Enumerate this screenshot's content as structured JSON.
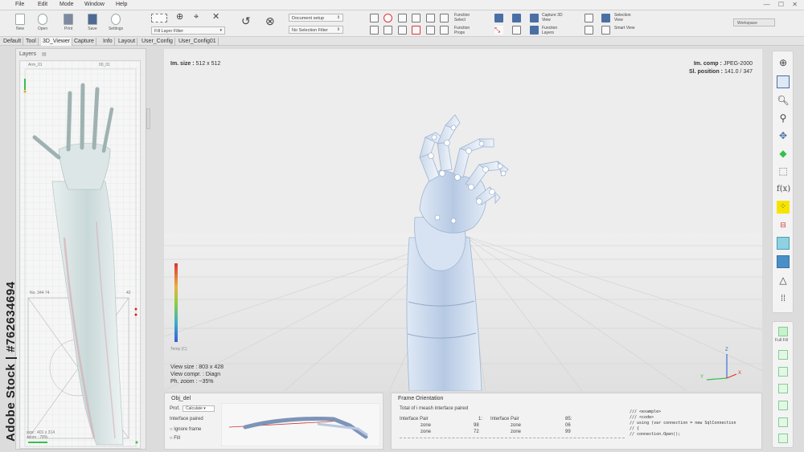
{
  "menu": [
    "File",
    "Edit",
    "Mode",
    "Window",
    "Help"
  ],
  "window_controls": "— ☐ ✕",
  "toolbar": {
    "big_buttons": [
      "New",
      "Open",
      "Print",
      "Save",
      "Settings"
    ],
    "layer_filter": "Fill Layer Filter",
    "document_setup": "Document setup",
    "selection_filter": "No Selection Filter",
    "function_select": "Function Select",
    "function_props": "Function Props",
    "capture_3d_view": "Capture 3D View",
    "function_layers": "Function Layers",
    "selection_view": "Selection View",
    "smart_view": "Smart View",
    "workspace": "Workspace"
  },
  "tabs": [
    "Default",
    "Tool",
    "3D_Viewer",
    "Capture",
    "Info",
    "Layout",
    "User_Config",
    "User_Config01"
  ],
  "layers": {
    "title": "Layers",
    "arm_label": "Arm_01",
    "corner_label": "00_01",
    "mid_label": "No. 344  74",
    "mid_right": "42",
    "bottom_label": "size : 401 x 314",
    "bottom_label2": "zoom : 78%"
  },
  "watermark": "Adobe Stock | #762634694",
  "viewport": {
    "im_size_label": "Im. size :",
    "im_size": "512 x 512",
    "im_comp_label": "Im. comp :",
    "im_comp": "JPEG-2000",
    "sl_pos_label": "Sl. position :",
    "sl_pos": "141.0 / 347",
    "view_size": "View size : 803 x 428",
    "view_compr": "View compr. : Diagn",
    "ph_zoom": "Ph. zoom : ~35%",
    "scale_top": "Temp (C)",
    "axis_z": "Z",
    "axis_y": "Y",
    "axis_x": "X"
  },
  "right_tools": [
    "crosshair-icon",
    "layout-icon",
    "zoom-in-icon",
    "zoom-out-icon",
    "move-icon",
    "cube-icon",
    "wire-cube-icon",
    "fx-icon",
    "points-icon",
    "ruler-icon",
    "grid-icon",
    "panel-icon",
    "cone-icon",
    "dots-icon"
  ],
  "fx_label": "f(x)",
  "full_fill": "Full Fill",
  "obj_panel": {
    "title": "Obj_del",
    "prof_label": "Prof.",
    "prof_value": "Calculate",
    "interface_paired": "Interface paired",
    "ignore_frame": "Ignore frame",
    "fill": "Fill"
  },
  "frame_panel": {
    "title": "Frame Orientation",
    "subtitle": "Total of i meash interface paired",
    "left_rows": [
      {
        "label": "Interface Pair",
        "value": "1:"
      },
      {
        "label": "zone",
        "value": "98"
      },
      {
        "label": "zone",
        "value": "72"
      }
    ],
    "right_rows": [
      {
        "label": "Interface Pair",
        "value": "85:"
      },
      {
        "label": "zone",
        "value": "06"
      },
      {
        "label": "zone",
        "value": "99"
      }
    ],
    "code": [
      "/// <example>",
      "/// <code>",
      "// using (var connection = new SqlConnection",
      "// {",
      "//    connection.Open();"
    ]
  },
  "colors": {
    "accent_yellow": "#f5e400",
    "green": "#35c04a",
    "hand": "#b8cce6"
  }
}
